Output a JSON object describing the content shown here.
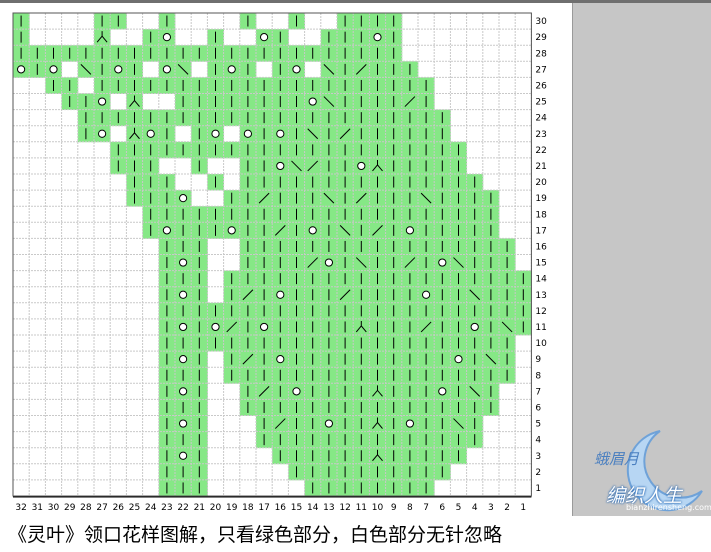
{
  "chart": {
    "columns": 32,
    "rows": 30,
    "row_labels": [
      "1",
      "2",
      "3",
      "4",
      "5",
      "6",
      "7",
      "8",
      "9",
      "10",
      "11",
      "12",
      "13",
      "14",
      "15",
      "16",
      "17",
      "18",
      "19",
      "20",
      "21",
      "22",
      "23",
      "24",
      "25",
      "26",
      "27",
      "28",
      "29",
      "30"
    ],
    "column_labels": [
      "32",
      "31",
      "30",
      "29",
      "28",
      "27",
      "26",
      "25",
      "24",
      "23",
      "22",
      "21",
      "20",
      "19",
      "18",
      "17",
      "16",
      "15",
      "14",
      "13",
      "12",
      "11",
      "10",
      "9",
      "8",
      "7",
      "6",
      "5",
      "4",
      "3",
      "2",
      "1"
    ],
    "colors": {
      "stitch_area": "#86e886",
      "empty_area": "#ffffff",
      "grid_line": "#c9c9c9",
      "symbol": "#000000",
      "side_panel": "#c6c6c6"
    },
    "legend_symbols": [
      "knit-stitch",
      "yarn-over",
      "k2tog-left",
      "k2tog-right",
      "sk2p"
    ]
  },
  "caption": "《灵叶》领口花样图解，只看绿色部分，白色部分无针忽略",
  "watermark": {
    "line1": "蛾眉月",
    "line2": "编织人生",
    "line3": "bianzhirensheng.com"
  }
}
